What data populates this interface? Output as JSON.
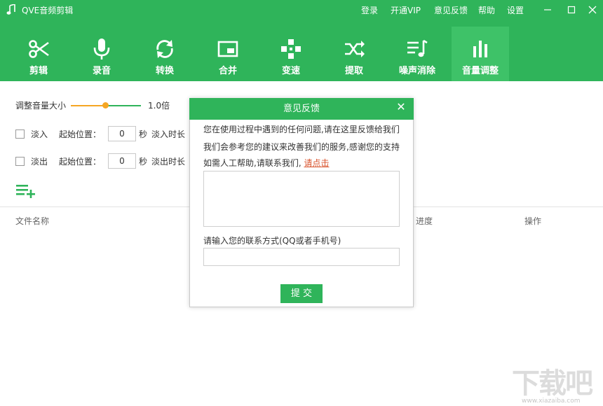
{
  "app": {
    "title": "QVE音频剪辑"
  },
  "top_links": [
    "登录",
    "开通VIP",
    "意见反馈",
    "帮助",
    "设置"
  ],
  "window_controls": [
    "minimize-icon",
    "maximize-icon",
    "close-icon"
  ],
  "tools": [
    {
      "label": "剪辑",
      "icon": "scissors-icon"
    },
    {
      "label": "录音",
      "icon": "microphone-icon"
    },
    {
      "label": "转换",
      "icon": "convert-icon"
    },
    {
      "label": "合并",
      "icon": "merge-icon"
    },
    {
      "label": "变速",
      "icon": "speed-icon"
    },
    {
      "label": "提取",
      "icon": "extract-icon"
    },
    {
      "label": "噪声消除",
      "icon": "noise-icon"
    },
    {
      "label": "音量调整",
      "icon": "volume-icon"
    }
  ],
  "active_tool": "音量调整",
  "volume": {
    "label": "调整音量大小",
    "value_text": "1.0倍",
    "level": 0.5
  },
  "fade_in": {
    "label": "淡入",
    "start_label": "起始位置：",
    "start_value": "0",
    "unit": "秒",
    "duration_label": "淡入时长"
  },
  "fade_out": {
    "label": "淡出",
    "start_label": "起始位置：",
    "start_value": "0",
    "unit": "秒",
    "duration_label": "淡出时长"
  },
  "table_headers": {
    "name": "文件名称",
    "progress": "进度",
    "action": "操作"
  },
  "dialog": {
    "title": "意见反馈",
    "line1": "您在使用过程中遇到的任何问题,请在这里反馈给我们",
    "line2": "我们会参考您的建议来改善我们的服务,感谢您的支持",
    "line3": "如需人工帮助,请联系我们,",
    "link": "请点击",
    "contact_label": "请输入您的联系方式(QQ或者手机号)",
    "submit": "提 交"
  },
  "watermark": {
    "text": "下载吧",
    "url": "www.xiazaiba.com"
  },
  "colors": {
    "brand": "#2fb45a",
    "active_tab": "#3ec268",
    "slider_left": "#f5a623",
    "link": "#d9532c"
  }
}
